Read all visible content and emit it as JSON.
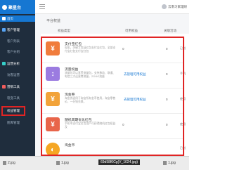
{
  "app": {
    "brand": "聚星台"
  },
  "user": {
    "name": "云南习家理财"
  },
  "sidebar": {
    "items": [
      {
        "label": "首页"
      },
      {
        "label": "客户管理"
      },
      {
        "label": "客户列表"
      },
      {
        "label": "客户分组"
      },
      {
        "label": "运营分析"
      },
      {
        "label": "访客运营"
      },
      {
        "label": "营销工具"
      },
      {
        "label": "裂变工具"
      },
      {
        "label": "权益管理"
      },
      {
        "label": "图库管理"
      }
    ],
    "badge": "运营分析"
  },
  "page": {
    "title": "平台权益"
  },
  "table": {
    "columns": [
      "权益类型",
      "可用权益",
      "关联活动"
    ],
    "rows": [
      {
        "name": "支付宝红包",
        "desc": "现金，关键字包括红包支付宝红包，全部支付宝红包支付宝红包",
        "value": "0",
        "count": "0",
        "icon": "¥",
        "color": "#f07c3c"
      },
      {
        "name": "流量权益",
        "desc": "流量包可以享受流量包，支持移动、联通、电信三大运营商流量，2G/4G流量",
        "link": "去管理可用权益",
        "count": "0",
        "icon": "↕",
        "color": "#9b7be0"
      },
      {
        "name": "淘金券",
        "desc": "淘金券适用于淘宝所有金币使用，淘宝零售价，一分钱兑换，",
        "link": "去管理可用权益",
        "count": "0",
        "icon": "¥",
        "color": "#f2a33a"
      },
      {
        "name": "随机周期优化红包",
        "desc": "手机中支付宝红包用户可获得随机红包权益及",
        "value": "0",
        "count": "0",
        "icon": "¥",
        "color": "#e8654a"
      },
      {
        "name": "淘金币",
        "desc": "",
        "value": "",
        "count": "",
        "icon": "◐",
        "color": "#f5a623"
      }
    ],
    "right_labels": [
      "已创",
      "手机",
      "使用",
      "使用",
      "已创"
    ]
  },
  "taskbar": {
    "items": [
      "2.jpg",
      "1.jpg",
      "69d58f0Cg(V_1024.jpg)",
      "1.jpg"
    ]
  }
}
